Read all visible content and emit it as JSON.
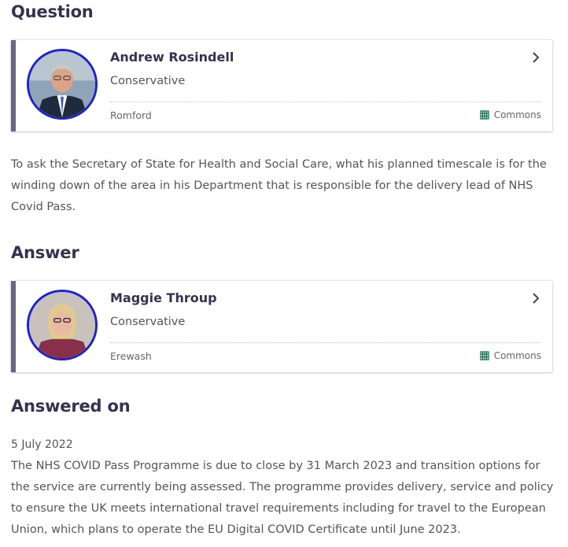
{
  "question": {
    "heading": "Question",
    "member": {
      "name": "Andrew Rosindell",
      "party": "Conservative",
      "constituency": "Romford",
      "house": "Commons"
    },
    "text": "To ask the Secretary of State for Health and Social Care, what his planned timescale is for the winding down of the area in his Department that is responsible for the delivery lead of NHS Covid Pass."
  },
  "answer": {
    "heading": "Answer",
    "member": {
      "name": "Maggie Throup",
      "party": "Conservative",
      "constituency": "Erewash",
      "house": "Commons"
    }
  },
  "answered_on": {
    "heading": "Answered on",
    "date": "5 July 2022",
    "text": "The NHS COVID Pass Programme is due to close by 31 March 2023 and transition options for the service are currently being assessed. The programme provides delivery, service and policy to ensure the UK meets international travel requirements including for travel to the European Union, which plans to operate the EU Digital COVID Certificate until June 2023."
  },
  "colors": {
    "heading": "#373151",
    "card_accent": "#6b6585",
    "avatar_ring": "#1d23c9",
    "commons_green": "#006e46"
  }
}
